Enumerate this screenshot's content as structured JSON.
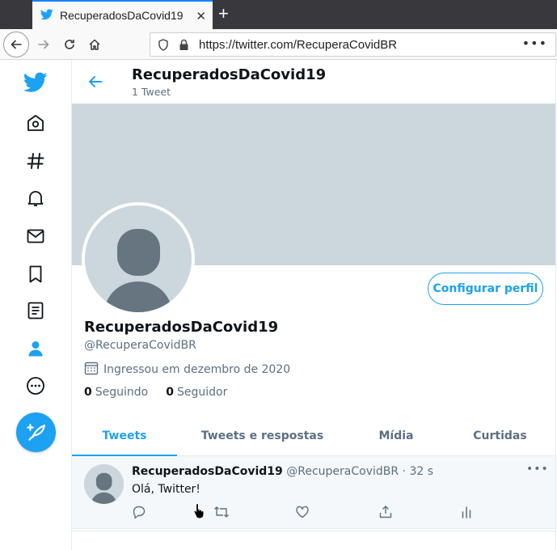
{
  "browser": {
    "tab_title": "RecuperadosDaCovid19",
    "tab_close": "✕",
    "new_tab": "+",
    "url": "https://twitter.com/RecuperaCovidBR",
    "url_menu": "•••"
  },
  "sidebar": {
    "items": [
      "home",
      "explore",
      "notifications",
      "messages",
      "bookmarks",
      "lists",
      "profile",
      "more"
    ]
  },
  "header": {
    "name": "RecuperadosDaCovid19",
    "tweet_count": "1 Tweet"
  },
  "profile": {
    "edit_button": "Configurar perfil",
    "name": "RecuperadosDaCovid19",
    "handle": "@RecuperaCovidBR",
    "joined": "Ingressou em dezembro de 2020",
    "following_count": "0",
    "following_label": "Seguindo",
    "followers_count": "0",
    "followers_label": "Seguidor"
  },
  "tabs": [
    {
      "label": "Tweets",
      "active": true
    },
    {
      "label": "Tweets e respostas",
      "active": false
    },
    {
      "label": "Mídia",
      "active": false
    },
    {
      "label": "Curtidas",
      "active": false
    }
  ],
  "tweet": {
    "name": "RecuperadosDaCovid19",
    "handle": "@RecuperaCovidBR",
    "dot": "·",
    "time": "32 s",
    "text": "Olá, Twitter!",
    "more": "•••"
  },
  "colors": {
    "accent": "#1da1f2",
    "secondary_text": "#5b7083",
    "banner": "#ccd6dd"
  }
}
